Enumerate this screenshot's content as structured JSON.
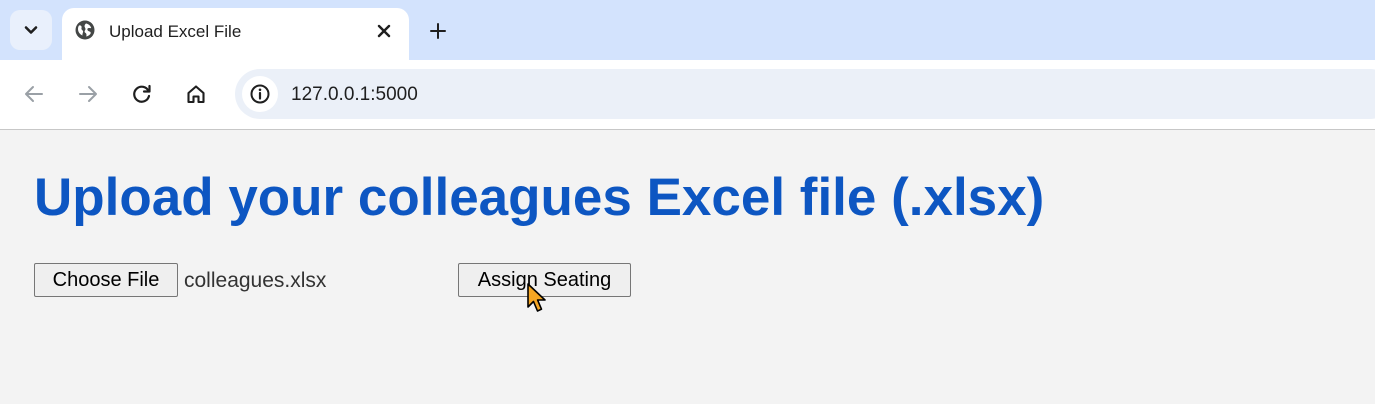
{
  "browser": {
    "tab_title": "Upload Excel File",
    "url": "127.0.0.1:5000",
    "icons": {
      "tab_search": "chevron-down-icon",
      "favicon": "globe-icon",
      "close": "close-icon",
      "new_tab": "plus-icon",
      "back": "arrow-left-icon",
      "forward": "arrow-right-icon",
      "reload": "reload-icon",
      "home": "home-icon",
      "site_info": "info-icon"
    }
  },
  "page": {
    "heading": "Upload your colleagues Excel file (.xlsx)",
    "choose_file_label": "Choose File",
    "selected_file": "colleagues.xlsx",
    "submit_label": "Assign Seating"
  },
  "colors": {
    "heading": "#0d56c2",
    "tabstrip": "#d3e3fd",
    "omnibox": "#ebf0f8",
    "page_background": "#f3f3f3",
    "cursor": "#f5a623"
  }
}
